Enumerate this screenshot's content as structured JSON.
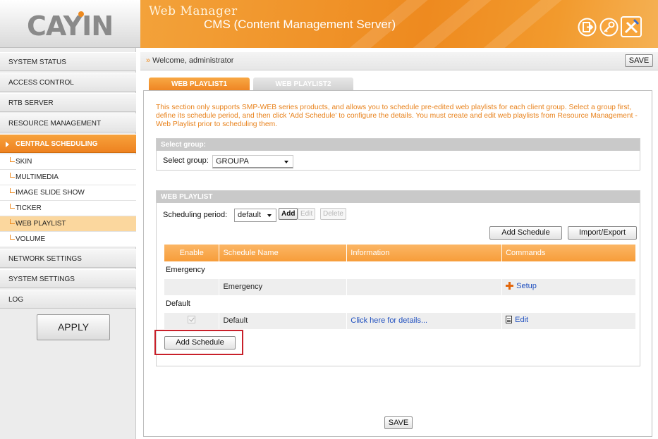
{
  "logo": {
    "text": "CAYIN"
  },
  "header": {
    "title": "Web Manager",
    "subtitle": "CMS (Content Management Server)",
    "icons": [
      "logout-icon",
      "key-icon",
      "tools-icon"
    ]
  },
  "sidebar": {
    "items": [
      {
        "label": "SYSTEM STATUS"
      },
      {
        "label": "ACCESS CONTROL"
      },
      {
        "label": "RTB SERVER"
      },
      {
        "label": "RESOURCE MANAGEMENT"
      },
      {
        "label": "CENTRAL SCHEDULING"
      }
    ],
    "subitems": [
      {
        "label": "SKIN"
      },
      {
        "label": "MULTIMEDIA"
      },
      {
        "label": "IMAGE SLIDE SHOW"
      },
      {
        "label": "TICKER"
      },
      {
        "label": "WEB PLAYLIST"
      },
      {
        "label": "VOLUME"
      }
    ],
    "bottom_items": [
      {
        "label": "NETWORK SETTINGS"
      },
      {
        "label": "SYSTEM SETTINGS"
      },
      {
        "label": "LOG"
      }
    ],
    "apply_label": "APPLY"
  },
  "topbar": {
    "welcome": "Welcome, administrator",
    "save_label": "SAVE"
  },
  "tabs": [
    {
      "label": "WEB PLAYLIST1"
    },
    {
      "label": "WEB PLAYLIST2"
    }
  ],
  "intro": "This section only supports SMP-WEB series products, and allows you to schedule pre-edited web playlists for each client group. Select a group first, define its schedule period, and then click 'Add Schedule' to configure the details. You must create and edit web playlists from Resource Management - Web Playlist prior to scheduling them.",
  "group_section": {
    "header": "Select group:",
    "label": "Select group:",
    "selected": "GROUPA"
  },
  "playlist_section": {
    "header": "WEB PLAYLIST",
    "period_label": "Scheduling period:",
    "period_selected": "default",
    "add_label": "Add",
    "edit_label": "Edit",
    "delete_label": "Delete",
    "add_schedule_label": "Add Schedule",
    "import_export_label": "Import/Export"
  },
  "table": {
    "columns": [
      "Enable",
      "Schedule Name",
      "Information",
      "Commands"
    ],
    "groups": [
      {
        "title": "Emergency",
        "row": {
          "name": "Emergency",
          "info": "",
          "command": "Setup"
        }
      },
      {
        "title": "Default",
        "row": {
          "name": "Default",
          "info": "Click here for details...",
          "command": "Edit"
        }
      }
    ]
  },
  "bottom": {
    "add_schedule_label": "Add Schedule",
    "save_label": "SAVE"
  },
  "colors": {
    "accent": "#ee8a1f",
    "table_header": "#f79d3a",
    "highlight": "#c8202a",
    "link": "#1f4fbf"
  }
}
